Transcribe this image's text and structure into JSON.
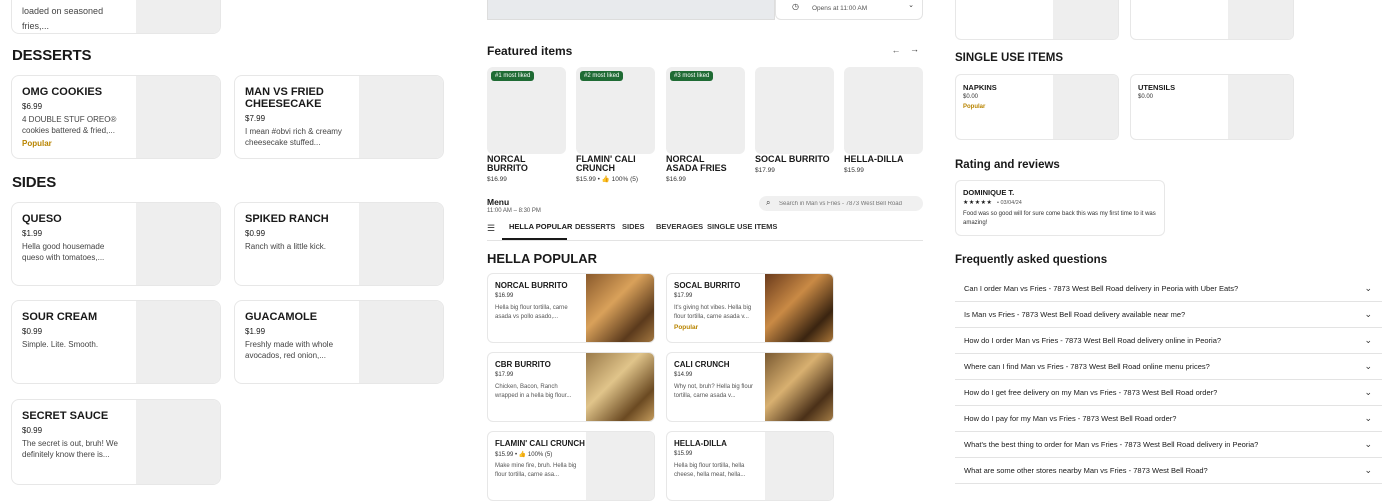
{
  "left": {
    "top_fragment": "loaded on seasoned fries,...",
    "desserts_title": "DESSERTS",
    "desserts": [
      {
        "name": "OMG COOKIES",
        "price": "$6.99",
        "desc": "4 DOUBLE STUF OREO® cookies battered & fried,...",
        "badge": "Popular"
      },
      {
        "name": "MAN VS FRIED CHEESECAKE",
        "price": "$7.99",
        "desc": "I mean #obvi rich & creamy cheesecake stuffed..."
      }
    ],
    "sides_title": "SIDES",
    "sides": [
      {
        "name": "QUESO",
        "price": "$1.99",
        "desc": "Hella good housemade queso with tomatoes,..."
      },
      {
        "name": "SPIKED RANCH",
        "price": "$0.99",
        "desc": "Ranch with a little kick."
      },
      {
        "name": "SOUR CREAM",
        "price": "$0.99",
        "desc": "Simple. Lite. Smooth."
      },
      {
        "name": "GUACAMOLE",
        "price": "$1.99",
        "desc": "Freshly made with whole avocados, red onion,..."
      },
      {
        "name": "SECRET SAUCE",
        "price": "$0.99",
        "desc": "The secret is out, bruh! We definitely know there is..."
      }
    ]
  },
  "middle": {
    "opens": "Opens at 11:00 AM",
    "featured_title": "Featured items",
    "featured": [
      {
        "badge": "#1 most liked",
        "name": "NORCAL BURRITO",
        "price": "$16.99"
      },
      {
        "badge": "#2 most liked",
        "name": "FLAMIN' CALI CRUNCH",
        "price": "$15.99 • 👍 100% (5)"
      },
      {
        "badge": "#3 most liked",
        "name": "NORCAL ASADA FRIES",
        "price": "$16.99"
      },
      {
        "badge": "",
        "name": "SOCAL BURRITO",
        "price": "$17.99"
      },
      {
        "badge": "",
        "name": "HELLA-DILLA",
        "price": "$15.99"
      }
    ],
    "menu_label": "Menu",
    "menu_hours": "11:00 AM – 8:30 PM",
    "search_placeholder": "Search in Man vs Fries - 7873 West Bell Road",
    "tabs": [
      "HELLA POPULAR",
      "DESSERTS",
      "SIDES",
      "BEVERAGES",
      "SINGLE USE ITEMS"
    ],
    "section_title": "HELLA POPULAR",
    "popular": [
      {
        "name": "NORCAL BURRITO",
        "price": "$16.99",
        "desc": "Hella big flour tortilla, carne asada vs pollo asado,..."
      },
      {
        "name": "SOCAL BURRITO",
        "price": "$17.99",
        "desc": "It's giving hot vibes. Hella big flour tortilla, carne asada v...",
        "badge": "Popular"
      },
      {
        "name": "CBR BURRITO",
        "price": "$17.99",
        "desc": "Chicken, Bacon, Ranch wrapped in a hella big flour..."
      },
      {
        "name": "CALI CRUNCH",
        "price": "$14.99",
        "desc": "Why not, bruh? Hella big flour tortilla, carne asada v..."
      },
      {
        "name": "FLAMIN' CALI CRUNCH",
        "price": "$15.99 • 👍 100% (5)",
        "desc": "Make mine fire, bruh. Hella big flour tortilla, carne asa..."
      },
      {
        "name": "HELLA-DILLA",
        "price": "$15.99",
        "desc": "Hella big flour tortilla, hella cheese, hella meat, hella..."
      }
    ]
  },
  "right": {
    "single_use_title": "SINGLE USE ITEMS",
    "single_use": [
      {
        "name": "NAPKINS",
        "price": "$0.00",
        "badge": "Popular"
      },
      {
        "name": "UTENSILS",
        "price": "$0.00"
      }
    ],
    "rating_title": "Rating and reviews",
    "review": {
      "author": "DOMINIQUE T.",
      "stars": "★★★★★",
      "date": "• 03/04/24",
      "text": "Food was so good will for sure come back this was my first time to it was amazing!"
    },
    "faq_title": "Frequently asked questions",
    "faqs": [
      "Can I order Man vs Fries - 7873 West Bell Road delivery in Peoria with Uber Eats?",
      "Is Man vs Fries - 7873 West Bell Road delivery available near me?",
      "How do I order Man vs Fries - 7873 West Bell Road delivery online in Peoria?",
      "Where can I find Man vs Fries - 7873 West Bell Road online menu prices?",
      "How do I get free delivery on my Man vs Fries - 7873 West Bell Road order?",
      "How do I pay for my Man vs Fries - 7873 West Bell Road order?",
      "What's the best thing to order for Man vs Fries - 7873 West Bell Road delivery in Peoria?",
      "What are some other stores nearby Man vs Fries - 7873 West Bell Road?"
    ]
  }
}
